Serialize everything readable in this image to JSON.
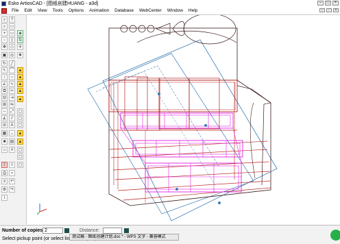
{
  "window": {
    "title": "Esko ArtiosCAD - [图纸创建HUANG - a3d]"
  },
  "menu": {
    "items": [
      "File",
      "Edit",
      "View",
      "Tools",
      "Options",
      "Animation",
      "Database",
      "WebCenter",
      "Window",
      "Help"
    ]
  },
  "status": {
    "copies_label": "Number of copies:",
    "copies_value": "2",
    "distance_label": "Distance:",
    "distance_value": "",
    "prompt": "Select pickup point (or select line to snap to)"
  },
  "taskbar_popup": {
    "text": "测试稿 - 图纸创建计划.doc * - WPS 文字 - 兼容模式"
  },
  "colors": {
    "structure": "#b8201e",
    "dark_structure": "#3a1a1a",
    "magenta": "#e11de1",
    "blue": "#3a7bb5",
    "accent_green": "#1c4f48"
  }
}
